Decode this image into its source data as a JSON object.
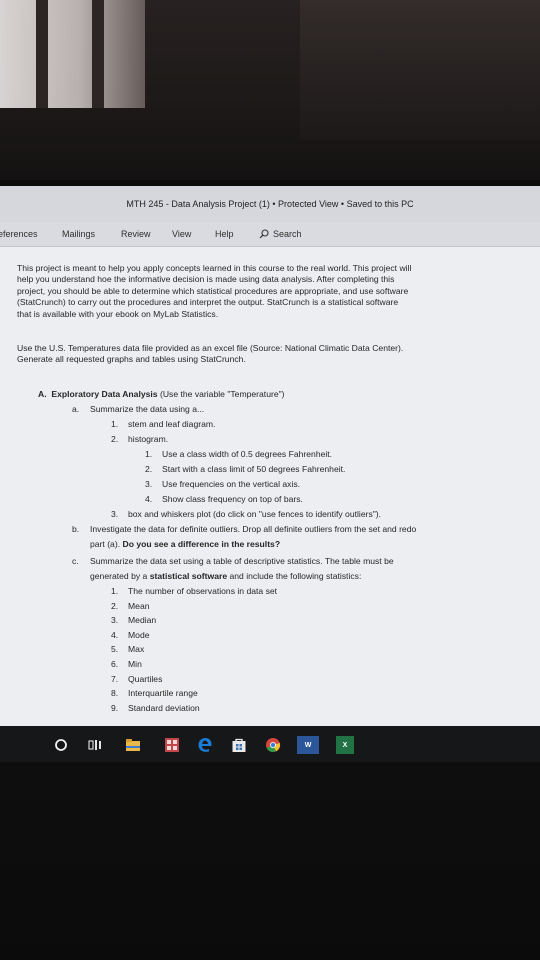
{
  "window": {
    "title": "MTH 245 - Data Analysis Project (1)  •  Protected View  •  Saved to this PC"
  },
  "ribbon": {
    "tabs": [
      "eferences",
      "Mailings",
      "Review",
      "View",
      "Help"
    ],
    "search_label": "Search"
  },
  "document": {
    "intro": [
      "This project is meant to help you apply concepts learned in this course to the real world. This project will",
      "help you understand hoe the informative decision is made using data analysis. After completing this",
      "project, you should be able to determine which statistical procedures are appropriate, and use software",
      "(StatCrunch) to carry out the procedures and interpret the output. StatCrunch is a statistical software",
      "that is available with your ebook on MyLab Statistics."
    ],
    "data_note": [
      "Use the U.S. Temperatures data file provided as an excel file (Source: National Climatic Data Center).",
      "Generate all requested graphs and tables using StatCrunch."
    ],
    "section_a": {
      "marker": "A.",
      "title": "Exploratory Data Analysis",
      "note": "(Use the variable \"Temperature\")"
    },
    "item_a": {
      "marker": "a.",
      "text": "Summarize the data using a...",
      "sub": [
        {
          "n": "1.",
          "text": "stem and leaf diagram."
        },
        {
          "n": "2.",
          "text": "histogram."
        }
      ],
      "histogram_sub": [
        {
          "n": "1.",
          "text": "Use a class width of 0.5 degrees Fahrenheit."
        },
        {
          "n": "2.",
          "text": "Start with a class limit of 50 degrees Fahrenheit."
        },
        {
          "n": "3.",
          "text": "Use frequencies on the vertical axis."
        },
        {
          "n": "4.",
          "text": "Show class frequency on top of bars."
        }
      ],
      "sub3": {
        "n": "3.",
        "text": "box and whiskers plot (do click on \"use fences to identify outliers\")."
      }
    },
    "item_b": {
      "marker": "b.",
      "line1": "Investigate the data for definite outliers. Drop all definite outliers from the set and redo",
      "line2_plain": "part (a). ",
      "line2_bold": "Do you see a difference in the results?"
    },
    "item_c": {
      "marker": "c.",
      "line1": "Summarize the data set using a table of descriptive statistics. The table must be",
      "line2_plain_1": "generated by a ",
      "line2_bold": "statistical software",
      "line2_plain_2": " and include the following statistics:",
      "stats": [
        {
          "n": "1.",
          "text": "The number of observations in data set"
        },
        {
          "n": "2.",
          "text": "Mean"
        },
        {
          "n": "3.",
          "text": "Median"
        },
        {
          "n": "4.",
          "text": "Mode"
        },
        {
          "n": "5.",
          "text": "Max"
        },
        {
          "n": "6.",
          "text": "Min"
        },
        {
          "n": "7.",
          "text": "Quartiles"
        },
        {
          "n": "8.",
          "text": "Interquartile range"
        },
        {
          "n": "9.",
          "text": "Standard deviation"
        }
      ]
    }
  },
  "taskbar": {
    "word_label": "W",
    "excel_label": "X",
    "colors": {
      "background": "#161719",
      "edge": "#1b7cd6",
      "word": "#2b579a",
      "excel": "#217346",
      "store": "#3a6fb4",
      "explorer": "#e8b84a"
    }
  }
}
